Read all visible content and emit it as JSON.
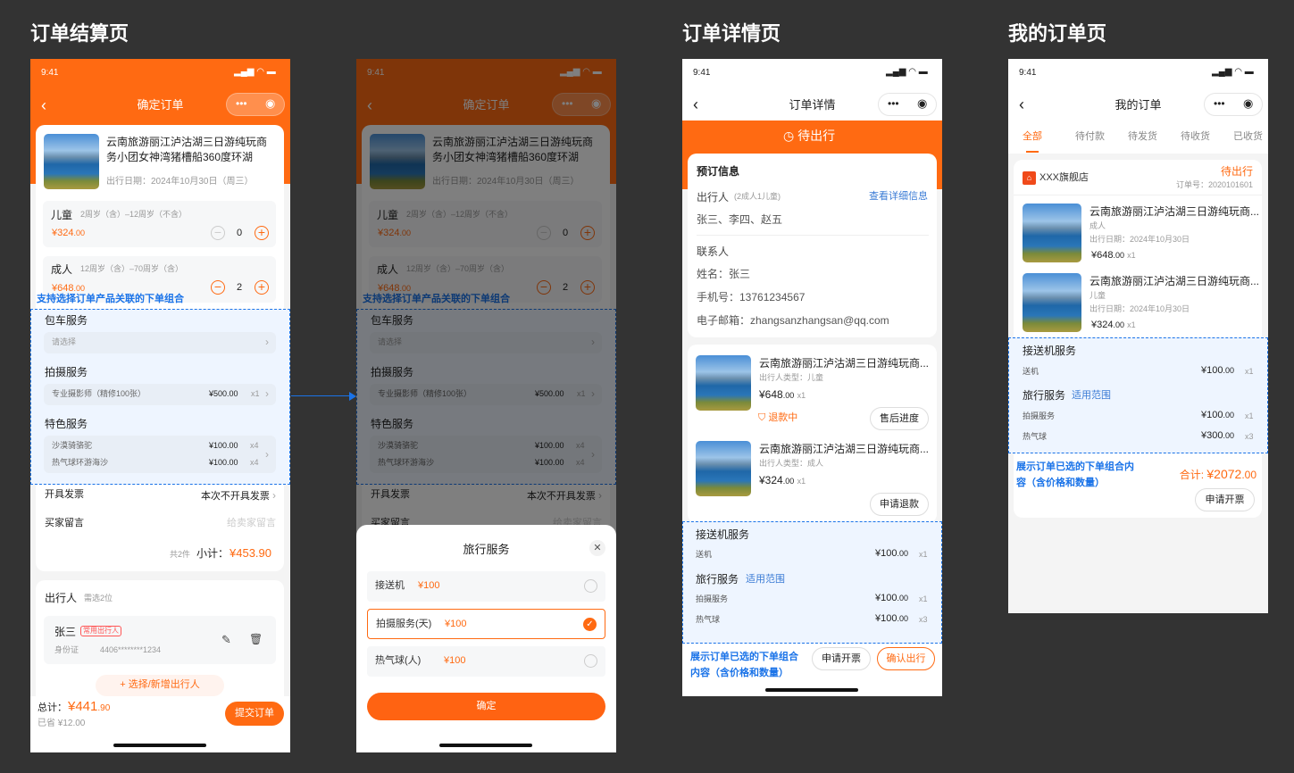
{
  "sections": {
    "checkout": "订单结算页",
    "detail": "订单详情页",
    "orders": "我的订单页"
  },
  "status_time": "9:41",
  "checkout": {
    "nav_title": "确定订单",
    "product": {
      "title_line1": "云南旅游丽江泸沽湖三日游纯玩商",
      "title_line2": "务小团女神湾猪槽船360度环湖",
      "date": "出行日期：2024年10月30日（周三）"
    },
    "tickets": [
      {
        "name": "儿童",
        "range": "2周岁（含）–12周岁（不含）",
        "price": "¥324",
        "price_dec": ".00",
        "qty": "0"
      },
      {
        "name": "成人",
        "range": "12周岁（含）–70周岁（含）",
        "price": "¥648",
        "price_dec": ".00",
        "qty": "2"
      }
    ],
    "annotation": "支持选择订单产品关联的下单组合",
    "charter": {
      "label": "包车服务",
      "placeholder": "请选择"
    },
    "photo": {
      "label": "拍摄服务",
      "item": "专业摄影师（精修100张）",
      "price": "¥500.00",
      "qty": "x1"
    },
    "special": {
      "label": "特色服务",
      "items": [
        {
          "name": "沙漠骑骆驼",
          "price": "¥100.00",
          "qty": "x4"
        },
        {
          "name": "热气球环游海沙",
          "price": "¥100.00",
          "qty": "x4"
        }
      ]
    },
    "invoice": {
      "label": "开具发票",
      "value": "本次不开具发票"
    },
    "message": {
      "label": "买家留言",
      "placeholder": "给卖家留言"
    },
    "subtotal": {
      "count": "共2件",
      "label": "小计：",
      "value": "¥453.90"
    },
    "travelers": {
      "title": "出行人",
      "hint": "需选2位",
      "name": "张三",
      "tag": "常用出行人",
      "id_label": "身份证",
      "id_value": "4406********1234",
      "add": "+ 选择/新增出行人"
    },
    "footer": {
      "total_label": "总计：",
      "total_int": "¥441",
      "total_dec": ".90",
      "saved": "已省 ¥12.00",
      "submit": "提交订单"
    }
  },
  "sheet": {
    "title": "旅行服务",
    "options": [
      {
        "name": "接送机",
        "price": "¥100",
        "selected": false
      },
      {
        "name": "拍摄服务(天)",
        "price": "¥100",
        "selected": true
      },
      {
        "name": "热气球(人)",
        "price": "¥100",
        "selected": false
      }
    ],
    "confirm": "确定"
  },
  "detail": {
    "nav_title": "订单详情",
    "status": "待出行",
    "booking": {
      "title": "预订信息",
      "travelers_label": "出行人",
      "travelers_count": "(2成人1儿童)",
      "view_more": "查看详细信息",
      "travelers": "张三、李四、赵五",
      "contact_label": "联系人",
      "name": "姓名：张三",
      "phone": "手机号：13761234567",
      "email": "电子邮箱：zhangsanzhangsan@qq.com"
    },
    "items": [
      {
        "title": "云南旅游丽江泸沽湖三日游纯玩商...",
        "type": "出行人类型：儿童",
        "price": "¥648",
        "dec": ".00",
        "qty": "x1",
        "refund": "退款中",
        "button": "售后进度"
      },
      {
        "title": "云南旅游丽江泸沽湖三日游纯玩商...",
        "type": "出行人类型：成人",
        "price": "¥324",
        "dec": ".00",
        "qty": "x1",
        "button": "申请退款"
      }
    ],
    "transfer": {
      "label": "接送机服务",
      "item": "送机",
      "price": "¥100",
      "dec": ".00",
      "qty": "x1"
    },
    "travel": {
      "label": "旅行服务",
      "link": "适用范围",
      "items": [
        {
          "name": "拍摄服务",
          "price": "¥100",
          "dec": ".00",
          "qty": "x1"
        },
        {
          "name": "热气球",
          "price": "¥100",
          "dec": ".00",
          "qty": "x3"
        }
      ]
    },
    "annotation": "展示订单已选的下单组合内容（含价格和数量）",
    "annotation_l1": "展示订单已选的下单组合",
    "annotation_l2": "内容（含价格和数量）",
    "invoice_btn": "申请开票",
    "confirm_btn": "确认出行"
  },
  "orders": {
    "nav_title": "我的订单",
    "tabs": [
      "全部",
      "待付款",
      "待发货",
      "待收货",
      "已收货"
    ],
    "shop": "XXX旗舰店",
    "status": "待出行",
    "order_no": "订单号：2020101601",
    "items": [
      {
        "title": "云南旅游丽江泸沽湖三日游纯玩商...",
        "type": "成人",
        "date": "出行日期：2024年10月30日",
        "price": "¥648",
        "dec": ".00",
        "qty": "x1"
      },
      {
        "title": "云南旅游丽江泸沽湖三日游纯玩商...",
        "type": "儿童",
        "date": "出行日期：2024年10月30日",
        "price": "¥324",
        "dec": ".00",
        "qty": "x1"
      }
    ],
    "transfer": {
      "label": "接送机服务",
      "item": "送机",
      "price": "¥100",
      "dec": ".00",
      "qty": "x1"
    },
    "travel": {
      "label": "旅行服务",
      "link": "适用范围",
      "items": [
        {
          "name": "拍摄服务",
          "price": "¥100",
          "dec": ".00",
          "qty": "x1"
        },
        {
          "name": "热气球",
          "price": "¥300",
          "dec": ".00",
          "qty": "x3"
        }
      ]
    },
    "annotation_l1": "展示订单已选的下单组合内",
    "annotation_l2": "容（含价格和数量）",
    "total_label": "合计: ",
    "total": "¥2072",
    "total_dec": ".00",
    "invoice_btn": "申请开票"
  },
  "colors": {
    "accent": "#ff6a12",
    "annotation": "#1a73e8"
  }
}
